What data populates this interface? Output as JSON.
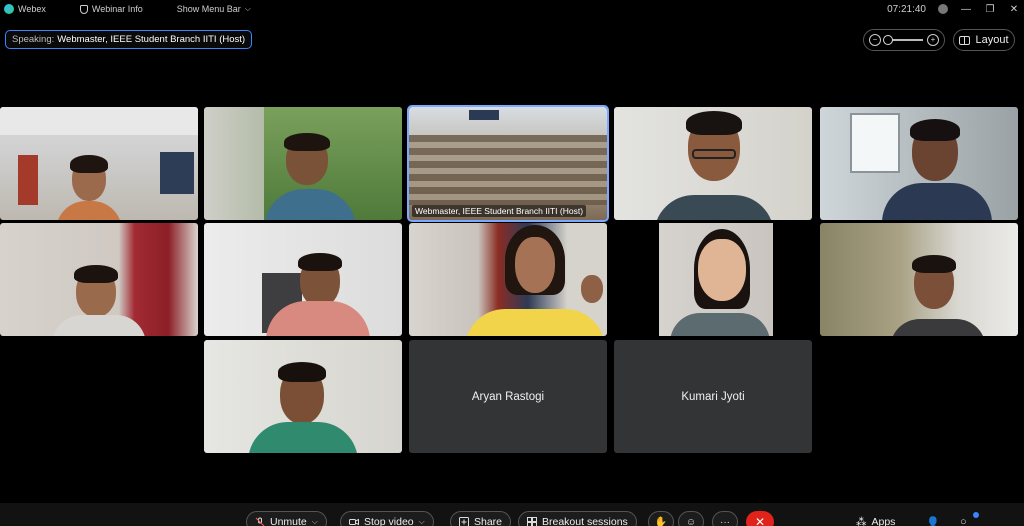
{
  "titlebar": {
    "app_name": "Webex",
    "webinar_info": "Webinar Info",
    "show_menu_bar": "Show Menu Bar",
    "time": "07:21:40",
    "minimize": "—",
    "restore": "❐",
    "close": "✕"
  },
  "speaking": {
    "label": "Speaking:",
    "name": "Webmaster, IEEE Student Branch IITI (Host)"
  },
  "layout_label": "Layout",
  "tiles": {
    "host_caption": "Webmaster, IEEE Student Branch IITI (Host)",
    "aryan": "Aryan Rastogi",
    "kumari": "Kumari Jyoti"
  },
  "controls": {
    "unmute": "Unmute",
    "stop_video": "Stop video",
    "share": "Share",
    "breakout": "Breakout sessions",
    "more": "···",
    "apps": "Apps"
  },
  "colors": {
    "accent": "#3a86ff",
    "end_call": "#e0241b",
    "tile_dark": "#333436"
  }
}
